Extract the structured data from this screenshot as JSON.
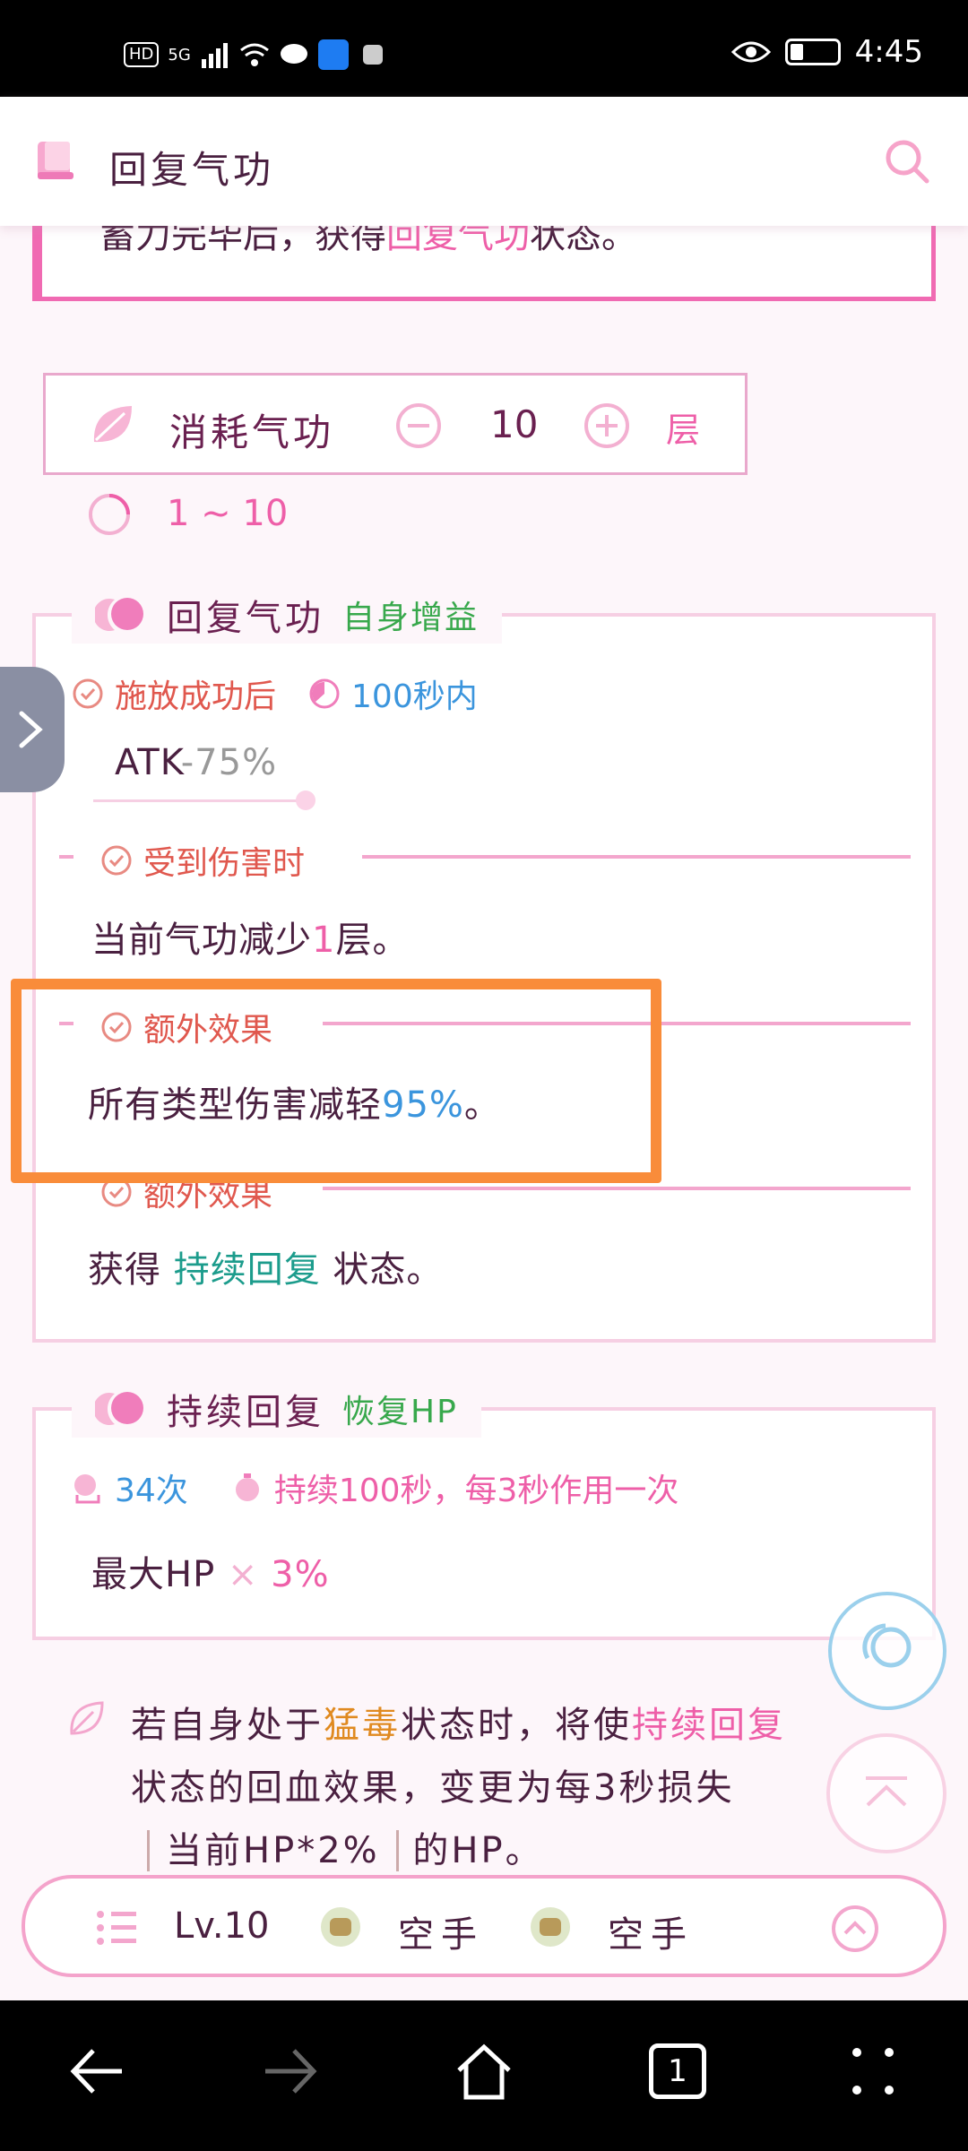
{
  "status": {
    "hd": "HD",
    "net": "5G",
    "time": "4:45"
  },
  "header": {
    "title": "回复气功"
  },
  "topcard": {
    "prefix": "蓄力完毕后，获得",
    "buff": "回复气功",
    "suffix": "状态。"
  },
  "consume": {
    "label": "消耗气功",
    "value": "10",
    "unit": "层",
    "range": "1 ~ 10"
  },
  "buff1": {
    "title": "回复气功",
    "tag": "自身增益",
    "trigger": "施放成功后",
    "duration": "100秒内",
    "stat": "ATK",
    "stat_mod": "-75%",
    "sections": [
      {
        "label": "受到伤害时",
        "text_a": "当前气功减少",
        "num": "1",
        "text_b": "层。"
      },
      {
        "label": "额外效果",
        "text_a": "所有类型伤害减轻",
        "num": "95%",
        "text_b": "。"
      },
      {
        "label": "额外效果",
        "text_a": "获得 ",
        "buff": "持续回复",
        "text_b": " 状态。"
      }
    ]
  },
  "buff2": {
    "title": "持续回复",
    "tag": "恢复HP",
    "count": "34次",
    "duration": "持续100秒，每3秒作用一次",
    "formula_a": "最大HP",
    "formula_op": "×",
    "formula_b": "3%"
  },
  "note": {
    "l1a": "若自身处于",
    "l1b": "猛毒",
    "l1c": "状态时，将使",
    "l1d": "持续回复",
    "l2": "状态的回血效果，变更为每3秒损失",
    "l3a": "当前HP*2%",
    "l3b": "的HP。"
  },
  "bottombar": {
    "level": "Lv.10",
    "weapon1": "空手",
    "weapon2": "空手"
  },
  "navbar": {
    "tabs": "1"
  },
  "colors": {
    "accent": "#ee5fa8",
    "highlight": "#f98c3a",
    "blue": "#3b95dd",
    "green": "#38a84c"
  }
}
